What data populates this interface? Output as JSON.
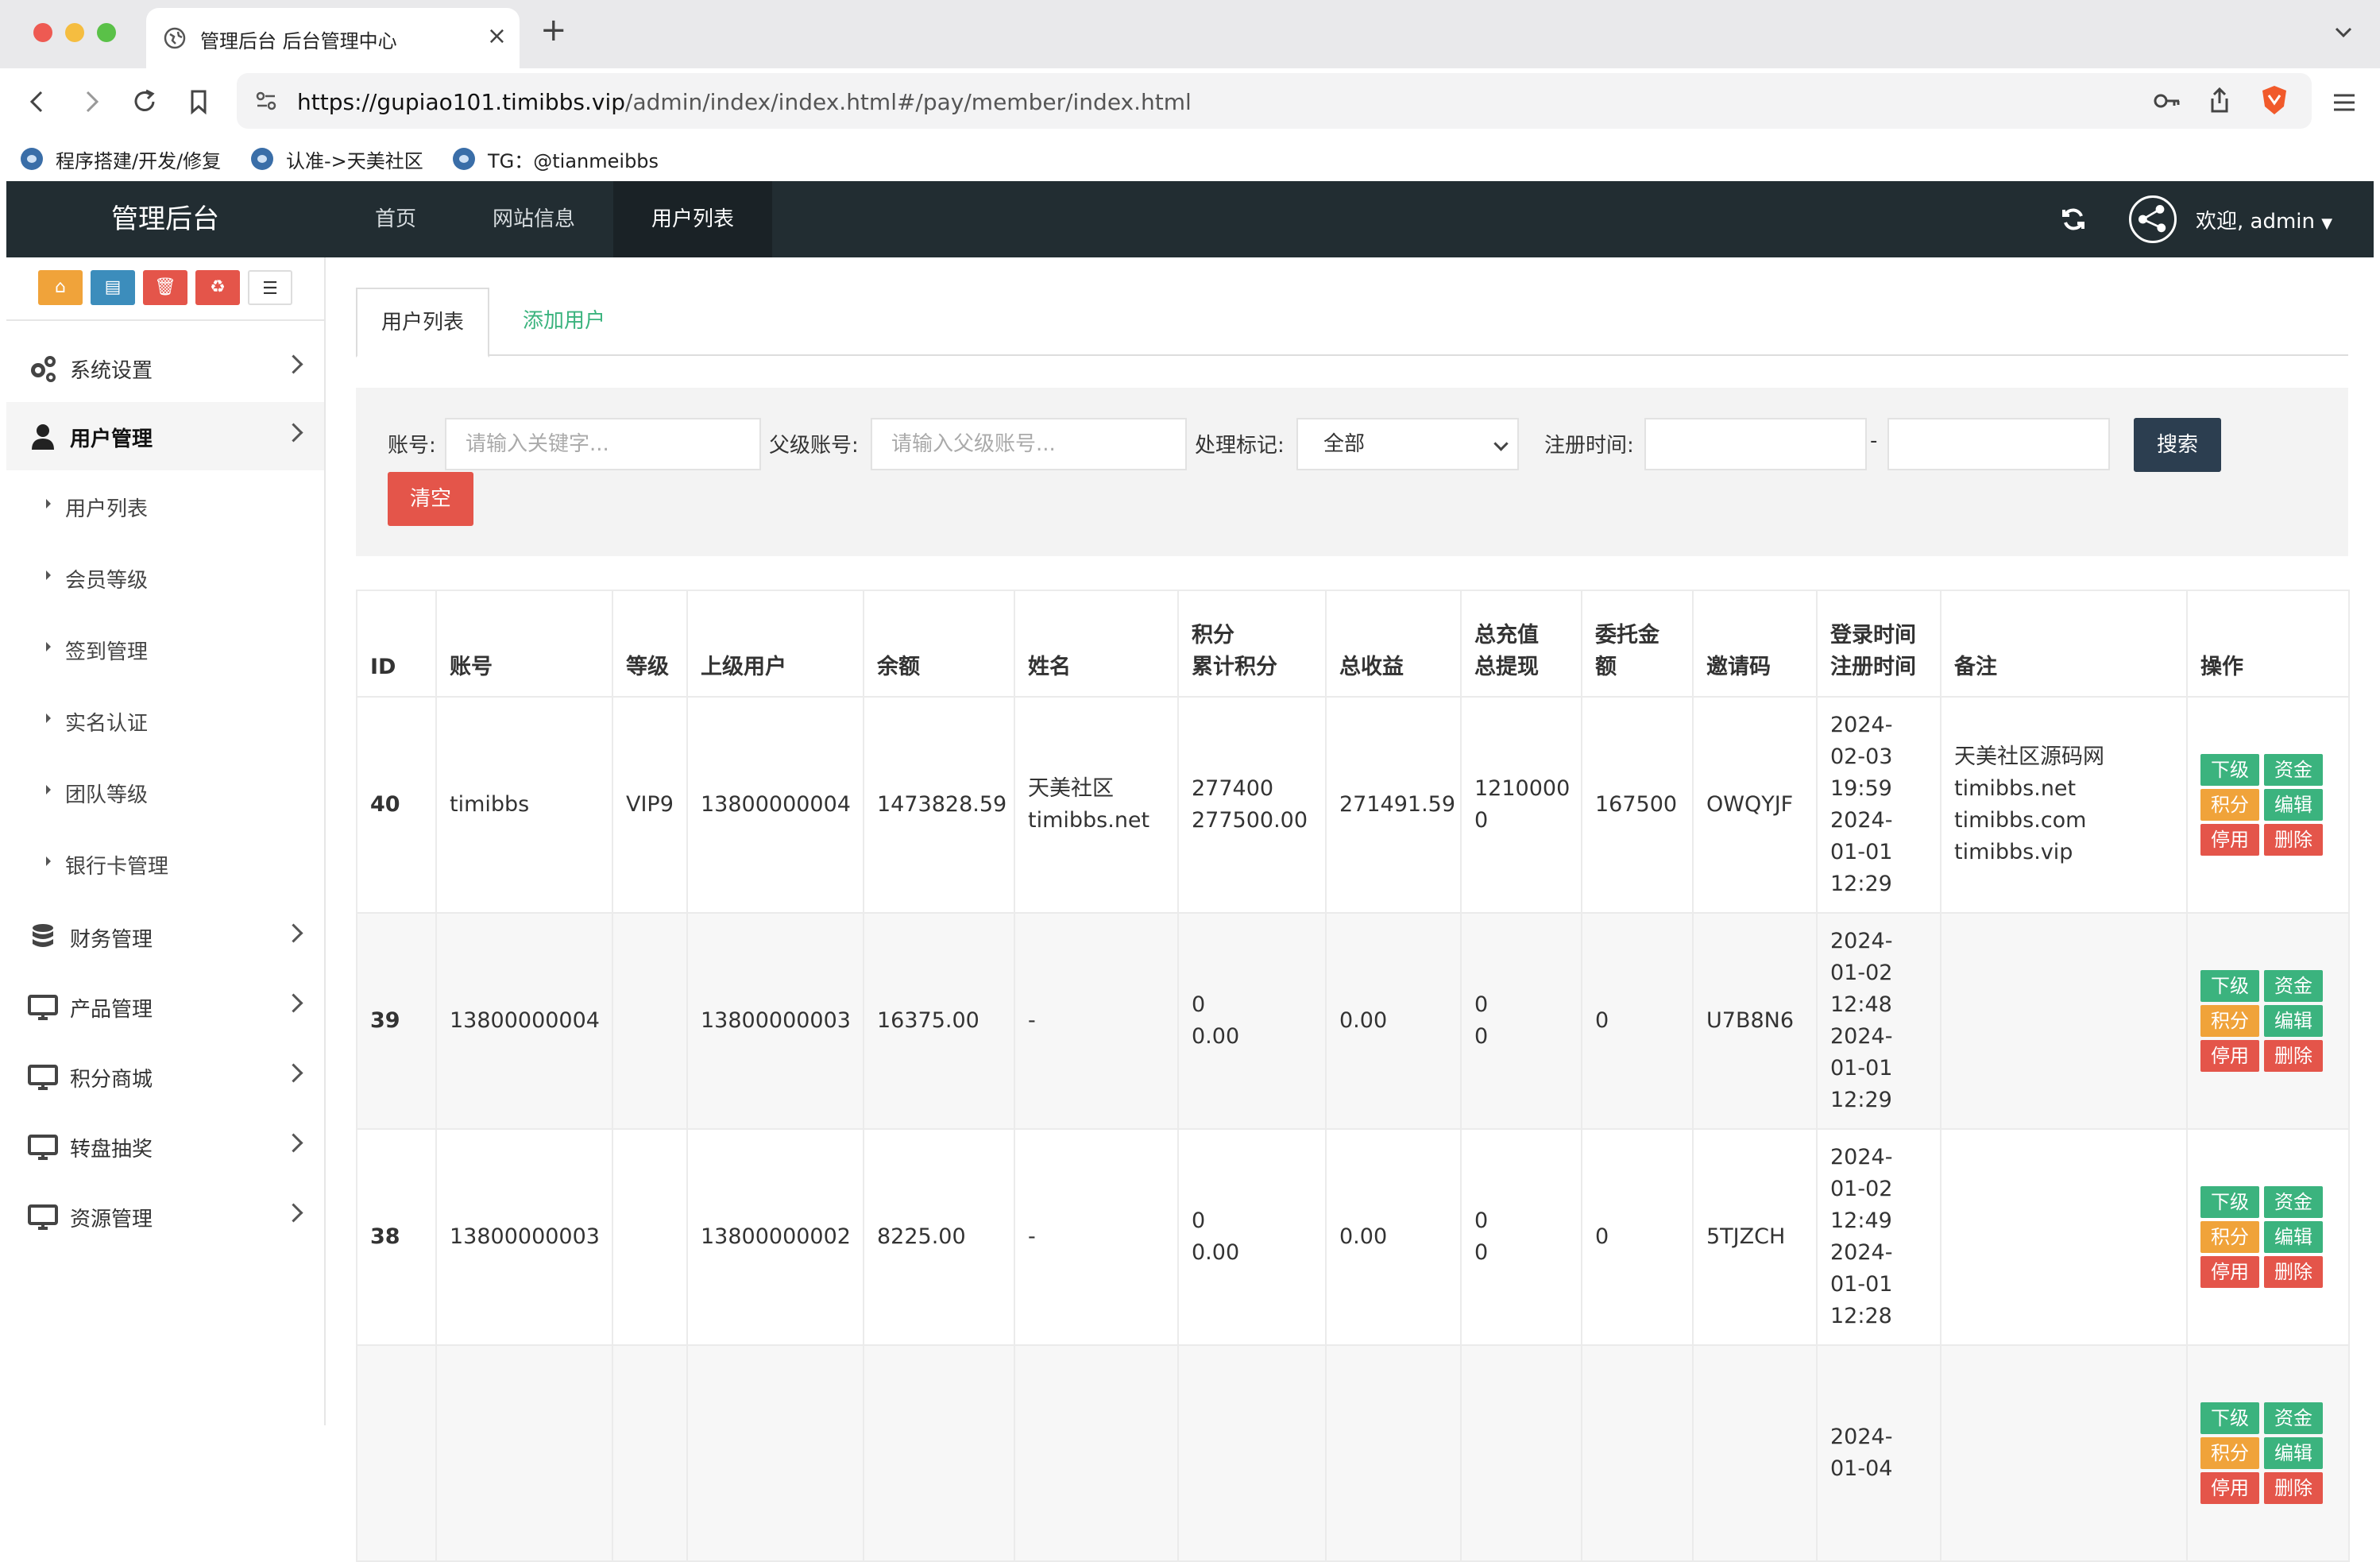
{
  "browser": {
    "tab_title": "管理后台 后台管理中心",
    "url_host": "https://gupiao101.timibbs.vip",
    "url_path": "/admin/index/index.html#/pay/member/index.html",
    "bookmarks": [
      "程序搭建/开发/修复",
      "认准->天美社区",
      "TG：@tianmeibbs"
    ]
  },
  "header": {
    "brand": "管理后台",
    "nav": [
      "首页",
      "网站信息",
      "用户列表"
    ],
    "active_nav": "用户列表",
    "welcome": "欢迎, admin"
  },
  "sidebar": {
    "quick_buttons": [
      {
        "icon": "home-icon",
        "color": "#f0a33a"
      },
      {
        "icon": "file-icon",
        "color": "#3c8dbc"
      },
      {
        "icon": "trash-icon",
        "color": "#e4554a"
      },
      {
        "icon": "recycle-icon",
        "color": "#e4554a"
      },
      {
        "icon": "list-icon",
        "color": "#ffffff"
      }
    ],
    "menu": [
      {
        "label": "系统设置",
        "icon": "gears-icon"
      },
      {
        "label": "用户管理",
        "icon": "user-icon"
      },
      {
        "label": "财务管理",
        "icon": "database-icon"
      },
      {
        "label": "产品管理",
        "icon": "monitor-icon"
      },
      {
        "label": "积分商城",
        "icon": "monitor-icon"
      },
      {
        "label": "转盘抽奖",
        "icon": "monitor-icon"
      },
      {
        "label": "资源管理",
        "icon": "monitor-icon"
      }
    ],
    "submenu": [
      "用户列表",
      "会员等级",
      "签到管理",
      "实名认证",
      "团队等级",
      "银行卡管理"
    ]
  },
  "content": {
    "tabs": [
      "用户列表",
      "添加用户"
    ],
    "filter": {
      "account_label": "账号:",
      "account_placeholder": "请输入关键字...",
      "parent_label": "父级账号:",
      "parent_placeholder": "请输入父级账号...",
      "mark_label": "处理标记:",
      "mark_value": "全部",
      "regtime_label": "注册时间:",
      "range_sep": "-",
      "search_button": "搜索",
      "clear_button": "清空"
    },
    "table": {
      "headers": [
        "ID",
        "账号",
        "等级",
        "上级用户",
        "余额",
        "姓名",
        "积分\n累计积分",
        "总收益",
        "总充值\n总提现",
        "委托金\n额",
        "邀请码",
        "登录时间\n注册时间",
        "备注",
        "操作"
      ],
      "op_labels": [
        "下级",
        "资金",
        "积分",
        "编辑",
        "停用",
        "删除"
      ],
      "rows": [
        {
          "id": "40",
          "account": "timibbs",
          "level": "VIP9",
          "parent": "13800000004",
          "balance": "1473828.59",
          "name": "天美社区\ntimibbs.net",
          "points": "277400\n277500.00",
          "income": "271491.59",
          "recharge": "1210000\n0",
          "entrust": "167500",
          "invite": "OWQYJF",
          "times": "2024-\n02-03\n19:59\n2024-\n01-01\n12:29",
          "note": "天美社区源码网\ntimibbs.net\ntimibbs.com\ntimibbs.vip"
        },
        {
          "id": "39",
          "account": "13800000004",
          "level": "",
          "parent": "13800000003",
          "balance": "16375.00",
          "name": "-",
          "points": "0\n0.00",
          "income": "0.00",
          "recharge": "0\n0",
          "entrust": "0",
          "invite": "U7B8N6",
          "times": "2024-\n01-02\n12:48\n2024-\n01-01\n12:29",
          "note": ""
        },
        {
          "id": "38",
          "account": "13800000003",
          "level": "",
          "parent": "13800000002",
          "balance": "8225.00",
          "name": "-",
          "points": "0\n0.00",
          "income": "0.00",
          "recharge": "0\n0",
          "entrust": "0",
          "invite": "5TJZCH",
          "times": "2024-\n01-02\n12:49\n2024-\n01-01\n12:28",
          "note": ""
        },
        {
          "id": "",
          "account": "",
          "level": "",
          "parent": "",
          "balance": "",
          "name": "",
          "points": "",
          "income": "",
          "recharge": "",
          "entrust": "",
          "invite": "",
          "times": "2024-\n01-04",
          "note": ""
        }
      ]
    }
  }
}
